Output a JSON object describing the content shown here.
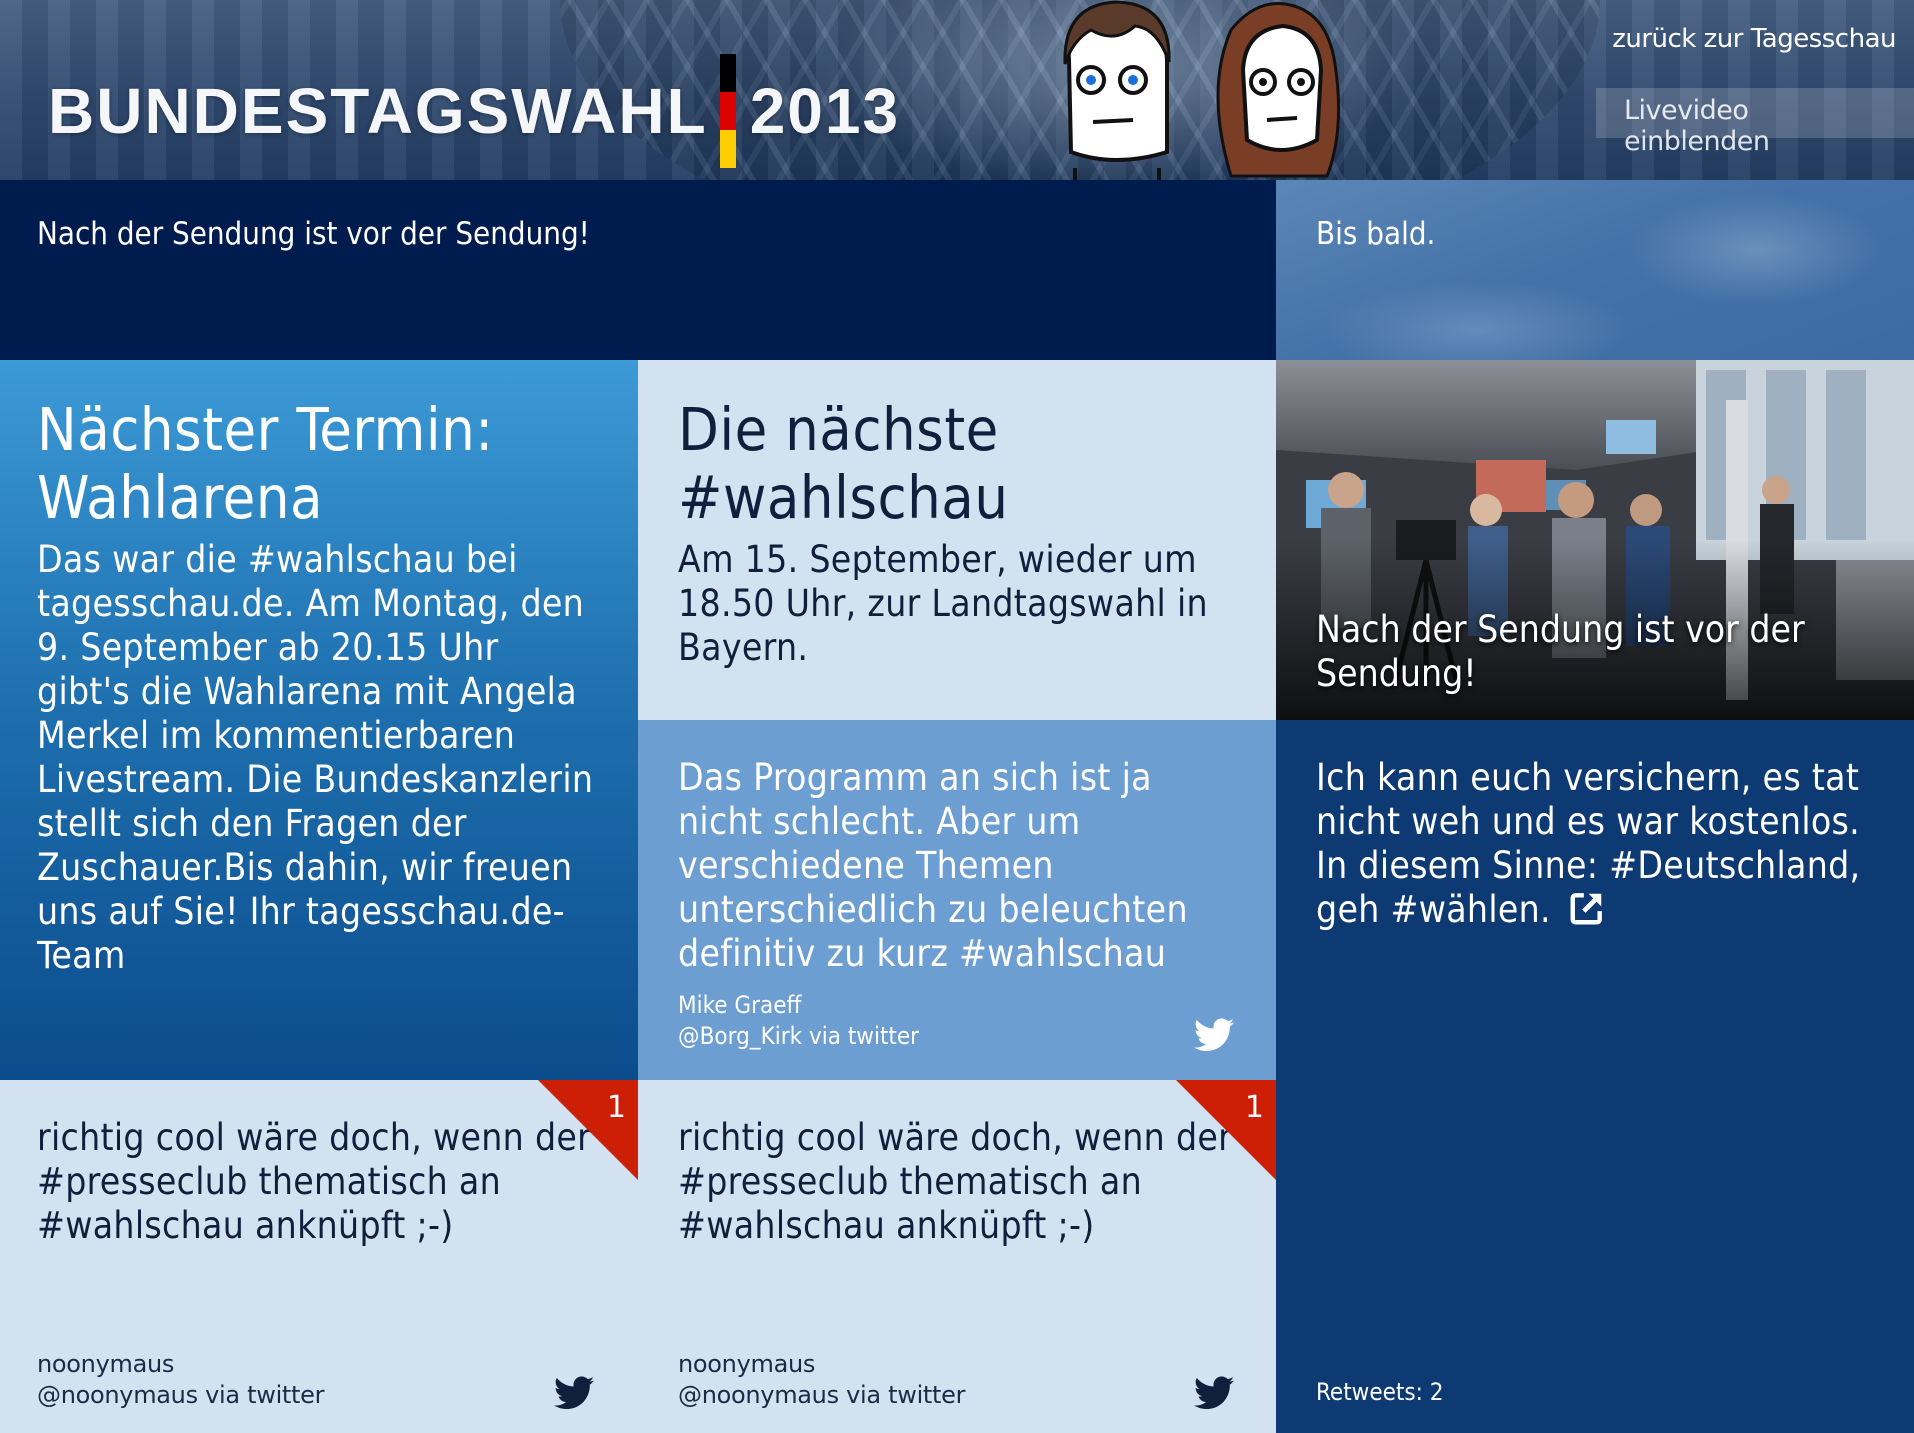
{
  "header": {
    "logo_text": "BUNDESTAGSWAHL",
    "logo_year": "2013",
    "back_link": "zurück zur Tagesschau",
    "livevideo_button": "Livevideo einblenden"
  },
  "banners": {
    "left": "Nach der Sendung ist vor der Sendung!",
    "right": "Bis bald."
  },
  "tiles": {
    "termin": {
      "title": "Nächster Termin: Wahlarena",
      "body": "Das war die #wahlschau bei tagesschau.de. Am Montag, den 9. September ab 20.15 Uhr gibt's die Wahlarena mit Angela Merkel im kommentierbaren Livestream. Die Bundeskanzlerin stellt sich den Fragen der Zuschauer.Bis dahin, wir freuen uns auf Sie! Ihr tagesschau.de-Team"
    },
    "naechste": {
      "title": "Die nächste #wahlschau",
      "body": "Am 15. September, wieder um 18.50 Uhr, zur Landtagswahl in Bayern."
    },
    "photo": {
      "caption": "Nach der Sendung ist vor der Sendung!"
    },
    "tweet_mike": {
      "text": "Das Programm an sich ist ja nicht schlecht. Aber um verschiedene Themen unterschiedlich zu beleuchten definitiv zu kurz #wahlschau",
      "author_name": "Mike Graeff",
      "author_handle": "@Borg_Kirk via twitter"
    },
    "tweet_retweet": {
      "text": "Ich kann euch versichern, es tat nicht weh und es war kostenlos. In diesem Sinne: #Deutschland, geh #wählen.",
      "retweets": "Retweets: 2"
    },
    "tweet_noony_1": {
      "text": "richtig cool wäre doch, wenn der #presseclub thematisch an #wahlschau anknüpft ;-)",
      "author_name": "noonymaus",
      "author_handle": "@noonymaus via twitter",
      "badge": "1"
    },
    "tweet_noony_2": {
      "text": "richtig cool wäre doch, wenn der #presseclub thematisch an #wahlschau anknüpft ;-)",
      "author_name": "noonymaus",
      "author_handle": "@noonymaus via twitter",
      "badge": "1"
    }
  },
  "colors": {
    "navy": "#001c4e",
    "tile_light": "#d2e2f1",
    "tile_mid": "#6c9ed1",
    "tile_dark": "#0e3a73",
    "badge_red": "#cc1f05",
    "flag": [
      "#000000",
      "#dd0000",
      "#ffce00"
    ]
  },
  "icons": [
    "twitter-bird-icon",
    "external-link-icon",
    "badge-corner-icon"
  ]
}
